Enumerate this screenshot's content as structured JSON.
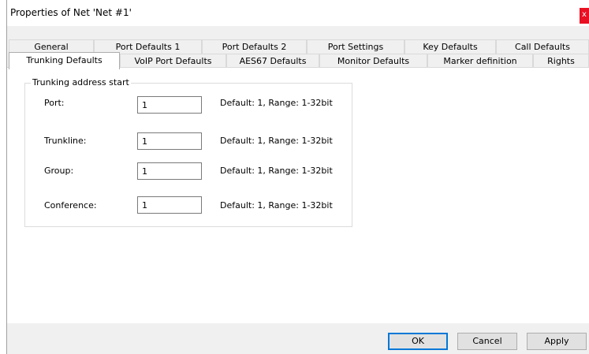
{
  "window": {
    "title": "Properties of Net 'Net #1'",
    "close_label": "x"
  },
  "tabs": {
    "row1": [
      "General",
      "Port Defaults 1",
      "Port Defaults 2",
      "Port Settings",
      "Key Defaults",
      "Call Defaults"
    ],
    "row2": [
      "Trunking Defaults",
      "VoIP Port Defaults",
      "AES67 Defaults",
      "Monitor Defaults",
      "Marker definition",
      "Rights"
    ],
    "active": "Trunking Defaults"
  },
  "group": {
    "title": "Trunking address start",
    "fields": [
      {
        "label": "Port:",
        "value": "1",
        "hint": "Default: 1, Range: 1-32bit"
      },
      {
        "label": "Trunkline:",
        "value": "1",
        "hint": "Default: 1, Range: 1-32bit"
      },
      {
        "label": "Group:",
        "value": "1",
        "hint": "Default: 1, Range: 1-32bit"
      },
      {
        "label": "Conference:",
        "value": "1",
        "hint": "Default: 1, Range: 1-32bit"
      }
    ]
  },
  "buttons": {
    "ok": "OK",
    "cancel": "Cancel",
    "apply": "Apply"
  }
}
